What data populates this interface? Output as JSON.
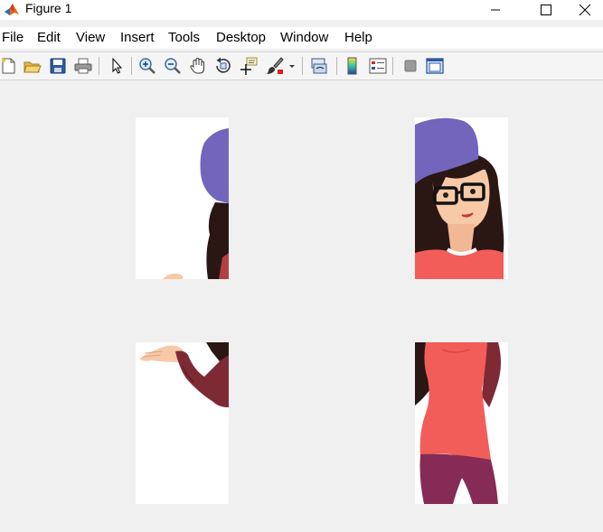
{
  "window": {
    "title": "Figure 1"
  },
  "menu": [
    "File",
    "Edit",
    "View",
    "Insert",
    "Tools",
    "Desktop",
    "Window",
    "Help"
  ],
  "toolbar": [
    "new-figure-icon",
    "open-file-icon",
    "save-icon",
    "print-icon",
    "edit-plot-arrow-icon",
    "zoom-in-icon",
    "zoom-out-icon",
    "pan-hand-icon",
    "rotate-3d-icon",
    "data-cursor-icon",
    "brush-icon",
    "brush-dropdown-icon",
    "link-plot-icon",
    "insert-colorbar-icon",
    "insert-legend-icon",
    "hide-plot-tools-icon",
    "show-plot-tools-icon"
  ],
  "colors": {
    "hat": "#7265bb",
    "hair": "#2a1714",
    "skin": "#f7c9a6",
    "top": "#f25d59",
    "sleeve": "#7e2a34",
    "pants": "#862b55"
  },
  "subplots": [
    "top-left-image-tile",
    "top-right-image-tile",
    "bottom-left-image-tile",
    "bottom-right-image-tile"
  ]
}
